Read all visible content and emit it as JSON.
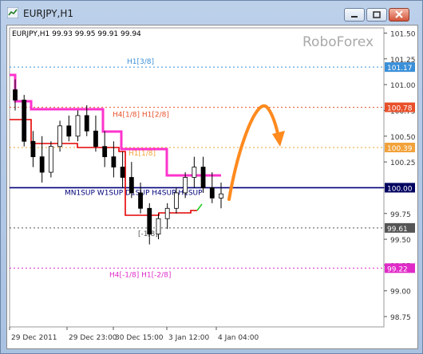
{
  "window": {
    "title": "EURJPY,H1",
    "buttons": [
      "minimize",
      "restore",
      "close"
    ]
  },
  "chart": {
    "symbol_info": "EURJPY,H1  99.93 99.95 99.91 99.94",
    "watermark": "RoboForex"
  },
  "chart_data": {
    "type": "candlestick",
    "symbol": "EURJPY",
    "timeframe": "H1",
    "ohlc_readout": {
      "open": 99.93,
      "high": 99.95,
      "low": 99.91,
      "close": 99.94
    },
    "current_price": 99.94,
    "y_ticks": [
      101.5,
      101.25,
      101.0,
      100.75,
      100.5,
      100.25,
      100.0,
      99.75,
      99.5,
      99.25,
      99.0,
      98.75
    ],
    "x_tick_labels": [
      "29 Dec 2011",
      "29 Dec 23:00",
      "30 Dec 15:00",
      "3 Jan 12:00",
      "4 Jan 04:00"
    ],
    "ylim": [
      98.65,
      101.55
    ],
    "levels": [
      {
        "label": "H1[3/8]",
        "value": 101.17,
        "color": "#3a8fd8"
      },
      {
        "label": "H4[1/8] H1[2/8]",
        "value": 100.78,
        "color": "#e8502a"
      },
      {
        "label": "H1[1/8]",
        "value": 100.39,
        "color": "#f2a23a"
      },
      {
        "label": "MN1SUP W1SUP D1SUP H4SUP H1SUP",
        "value": 100.0,
        "color": "#00007a"
      },
      {
        "label": "[-1/8]",
        "value": 99.61,
        "color": "#555555"
      },
      {
        "label": "H4[-1/8] H1[-2/8]",
        "value": 99.22,
        "color": "#e02ac8"
      }
    ],
    "forecast_arrow": "orange curved arrow pointing up then down",
    "candles_approx": [
      {
        "t": 0,
        "o": 100.95,
        "h": 101.05,
        "l": 100.75,
        "c": 100.85
      },
      {
        "t": 1,
        "o": 100.85,
        "h": 100.9,
        "l": 100.4,
        "c": 100.45
      },
      {
        "t": 2,
        "o": 100.45,
        "h": 100.55,
        "l": 100.2,
        "c": 100.3
      },
      {
        "t": 3,
        "o": 100.3,
        "h": 100.5,
        "l": 100.05,
        "c": 100.15
      },
      {
        "t": 4,
        "o": 100.15,
        "h": 100.45,
        "l": 100.1,
        "c": 100.4
      },
      {
        "t": 5,
        "o": 100.4,
        "h": 100.65,
        "l": 100.35,
        "c": 100.6
      },
      {
        "t": 6,
        "o": 100.6,
        "h": 100.7,
        "l": 100.45,
        "c": 100.5
      },
      {
        "t": 7,
        "o": 100.5,
        "h": 100.75,
        "l": 100.45,
        "c": 100.7
      },
      {
        "t": 8,
        "o": 100.7,
        "h": 100.8,
        "l": 100.5,
        "c": 100.55
      },
      {
        "t": 9,
        "o": 100.55,
        "h": 100.7,
        "l": 100.35,
        "c": 100.4
      },
      {
        "t": 10,
        "o": 100.4,
        "h": 100.55,
        "l": 100.2,
        "c": 100.3
      },
      {
        "t": 11,
        "o": 100.3,
        "h": 100.45,
        "l": 100.1,
        "c": 100.2
      },
      {
        "t": 12,
        "o": 100.2,
        "h": 100.35,
        "l": 100.0,
        "c": 100.1
      },
      {
        "t": 13,
        "o": 100.1,
        "h": 100.25,
        "l": 99.9,
        "c": 99.95
      },
      {
        "t": 14,
        "o": 99.95,
        "h": 100.05,
        "l": 99.75,
        "c": 99.8
      },
      {
        "t": 15,
        "o": 99.8,
        "h": 99.85,
        "l": 99.45,
        "c": 99.55
      },
      {
        "t": 16,
        "o": 99.55,
        "h": 99.75,
        "l": 99.5,
        "c": 99.7
      },
      {
        "t": 17,
        "o": 99.7,
        "h": 99.85,
        "l": 99.6,
        "c": 99.8
      },
      {
        "t": 18,
        "o": 99.8,
        "h": 100.0,
        "l": 99.75,
        "c": 99.95
      },
      {
        "t": 19,
        "o": 99.95,
        "h": 100.15,
        "l": 99.9,
        "c": 100.1
      },
      {
        "t": 20,
        "o": 100.1,
        "h": 100.3,
        "l": 100.0,
        "c": 100.2
      },
      {
        "t": 21,
        "o": 100.2,
        "h": 100.3,
        "l": 99.95,
        "c": 100.0
      },
      {
        "t": 22,
        "o": 100.0,
        "h": 100.15,
        "l": 99.85,
        "c": 99.9
      },
      {
        "t": 23,
        "o": 99.9,
        "h": 100.05,
        "l": 99.8,
        "c": 99.94
      }
    ]
  }
}
